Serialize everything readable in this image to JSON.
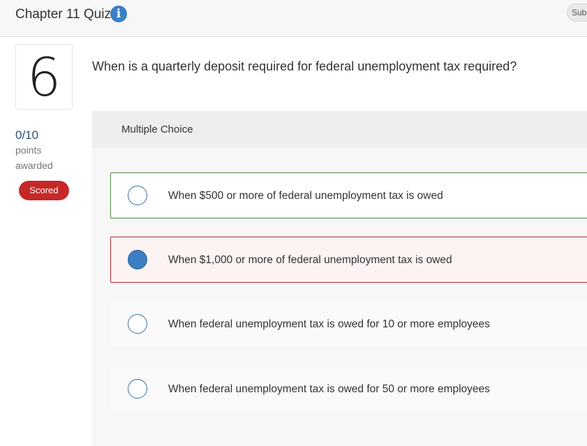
{
  "header": {
    "title": "Chapter 11 Quiz",
    "info_icon": "info-icon",
    "submit_label": "Sub"
  },
  "question": {
    "number": "6",
    "text": "When is a quarterly deposit required for federal unemployment tax required?",
    "score": "0/10",
    "score_unit": "points",
    "score_status": "awarded",
    "badge": "Scored"
  },
  "answer_panel": {
    "type_label": "Multiple Choice",
    "choices": [
      {
        "label": "When $500 or more of federal unemployment tax is owed",
        "selected": false,
        "state": "correct"
      },
      {
        "label": "When $1,000 or more of federal unemployment tax is owed",
        "selected": true,
        "state": "incorrect"
      },
      {
        "label": "When federal unemployment tax is owed for 10 or more employees",
        "selected": false,
        "state": "neutral"
      },
      {
        "label": "When federal unemployment tax is owed for 50 or more employees",
        "selected": false,
        "state": "neutral"
      }
    ]
  },
  "colors": {
    "accent": "#3b7fc4",
    "correct_border": "#4a8a3c",
    "incorrect_border": "#b3262d",
    "badge": "#c62828"
  }
}
